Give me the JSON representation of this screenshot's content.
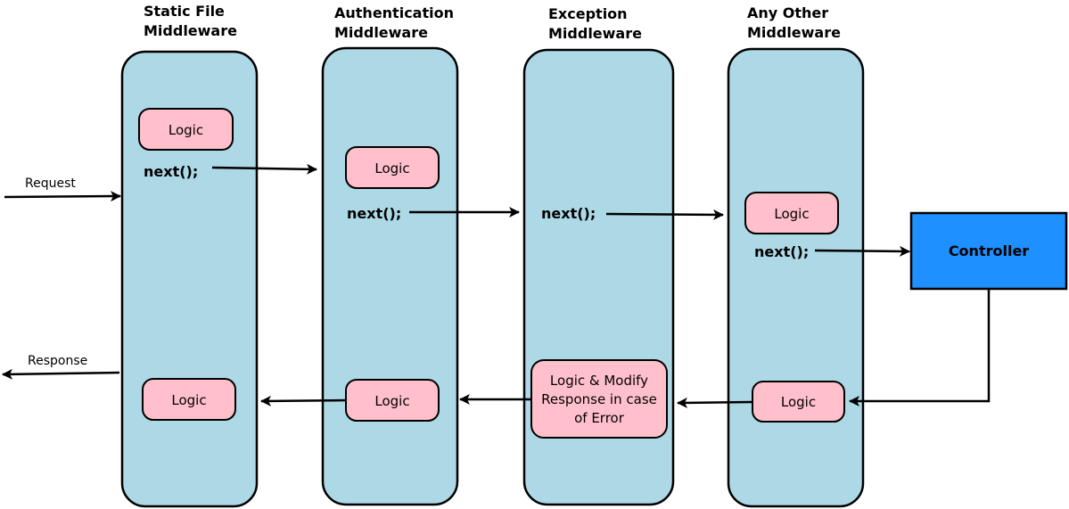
{
  "colors": {
    "middleware_fill": "#add8e6",
    "logic_fill": "#ffc0cb",
    "controller_fill": "#1e90ff",
    "stroke": "#000000"
  },
  "middlewares": [
    {
      "title_line1": "Static File",
      "title_line2": "Middleware",
      "pre_logic": "Logic",
      "next_call": "next();",
      "post_logic": "Logic"
    },
    {
      "title_line1": "Authentication",
      "title_line2": "Middleware",
      "pre_logic": "Logic",
      "next_call": "next();",
      "post_logic": "Logic"
    },
    {
      "title_line1": "Exception",
      "title_line2": "Middleware",
      "pre_logic": null,
      "next_call": "next();",
      "post_logic_lines": [
        "Logic & Modify",
        "Response in case",
        "of Error"
      ]
    },
    {
      "title_line1": "Any Other",
      "title_line2": "Middleware",
      "pre_logic": "Logic",
      "next_call": "next();",
      "post_logic": "Logic"
    }
  ],
  "controller": {
    "label": "Controller"
  },
  "flow": {
    "request_label": "Request",
    "response_label": "Response"
  }
}
